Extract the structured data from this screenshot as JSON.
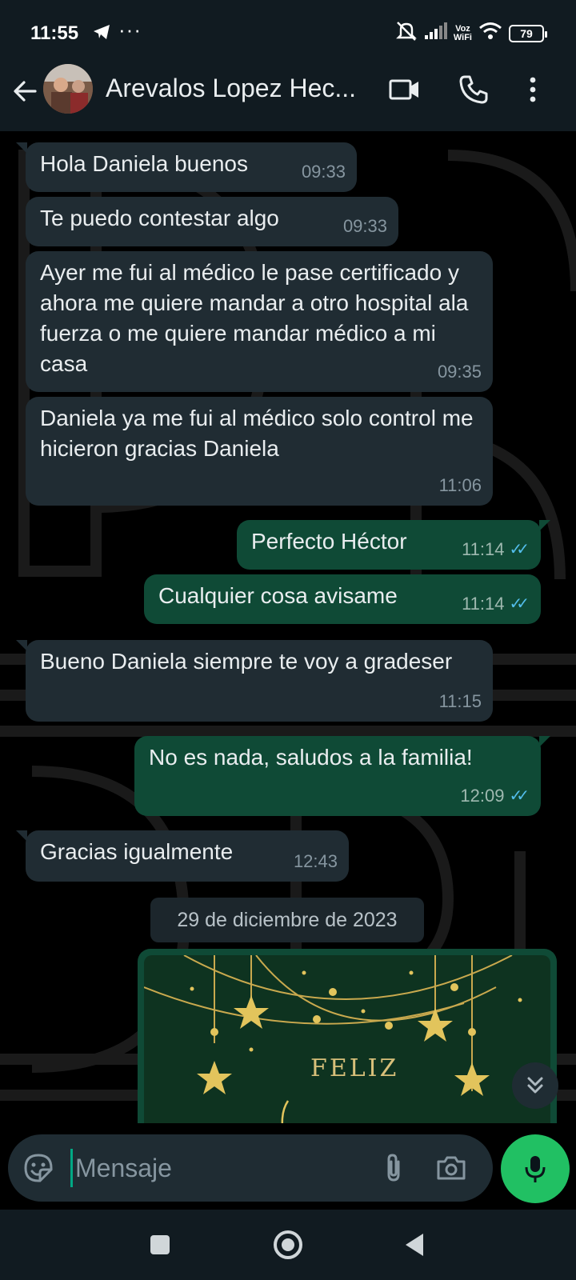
{
  "status_bar": {
    "time": "11:55",
    "overflow": "···",
    "voz_line1": "Voz",
    "voz_line2": "WiFi",
    "battery": "79",
    "icons": [
      "telegram-icon",
      "mute-icon",
      "signal-icon",
      "wifi-icon",
      "battery-icon"
    ]
  },
  "header": {
    "contact_name": "Arevalos Lopez Hec...",
    "icons": [
      "back-arrow-icon",
      "video-call-icon",
      "phone-icon",
      "more-vertical-icon"
    ]
  },
  "messages": [
    {
      "dir": "in",
      "text": "Hola Daniela buenos",
      "time": "09:33"
    },
    {
      "dir": "in",
      "text": "Te puedo contestar algo",
      "time": "09:33"
    },
    {
      "dir": "in",
      "text": "Ayer me fui al médico le pase certificado y ahora me quiere mandar a otro hospital ala fuerza o me quiere mandar médico a mi casa",
      "time": "09:35"
    },
    {
      "dir": "in",
      "text": "Daniela ya me fui al médico solo control me hicieron gracias Daniela",
      "time": "11:06"
    },
    {
      "dir": "out",
      "text": "Perfecto Héctor",
      "time": "11:14",
      "status": "read"
    },
    {
      "dir": "out",
      "text": "Cualquier cosa avisame",
      "time": "11:14",
      "status": "read"
    },
    {
      "dir": "in",
      "text": "Bueno Daniela siempre te voy a gradeser",
      "time": "11:15"
    },
    {
      "dir": "out",
      "text": "No es nada, saludos a la familia!",
      "time": "12:09",
      "status": "read"
    },
    {
      "dir": "in",
      "text": "Gracias igualmente",
      "time": "12:43"
    }
  ],
  "date_separator": "29 de diciembre de 2023",
  "image_message": {
    "visible_text": "FELIZ"
  },
  "input": {
    "placeholder": "Mensaje",
    "value": ""
  },
  "colors": {
    "incoming_bubble": "#202c33",
    "outgoing_bubble": "#0f4a36",
    "mic_button": "#21c063",
    "read_ticks": "#53bdeb"
  }
}
